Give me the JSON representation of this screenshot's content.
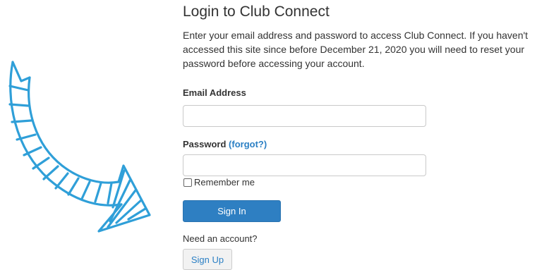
{
  "login": {
    "title": "Login to Club Connect",
    "intro": "Enter your email address and password to access Club Connect. If you haven't accessed this site since before December 21, 2020 you will need to reset your password before accessing your account.",
    "email_label": "Email Address",
    "email_value": "",
    "password_label": "Password",
    "forgot_link": "(forgot?)",
    "password_value": "",
    "remember_label": "Remember me",
    "remember_checked": false,
    "sign_in_label": "Sign In",
    "need_account_text": "Need an account?",
    "sign_up_label": "Sign Up"
  },
  "decoration": {
    "arrow_icon": "hand-drawn-curved-arrow-icon",
    "arrow_color": "#2f9fd8"
  },
  "colors": {
    "primary_button": "#2e7fc2",
    "link": "#2a7fc4"
  }
}
